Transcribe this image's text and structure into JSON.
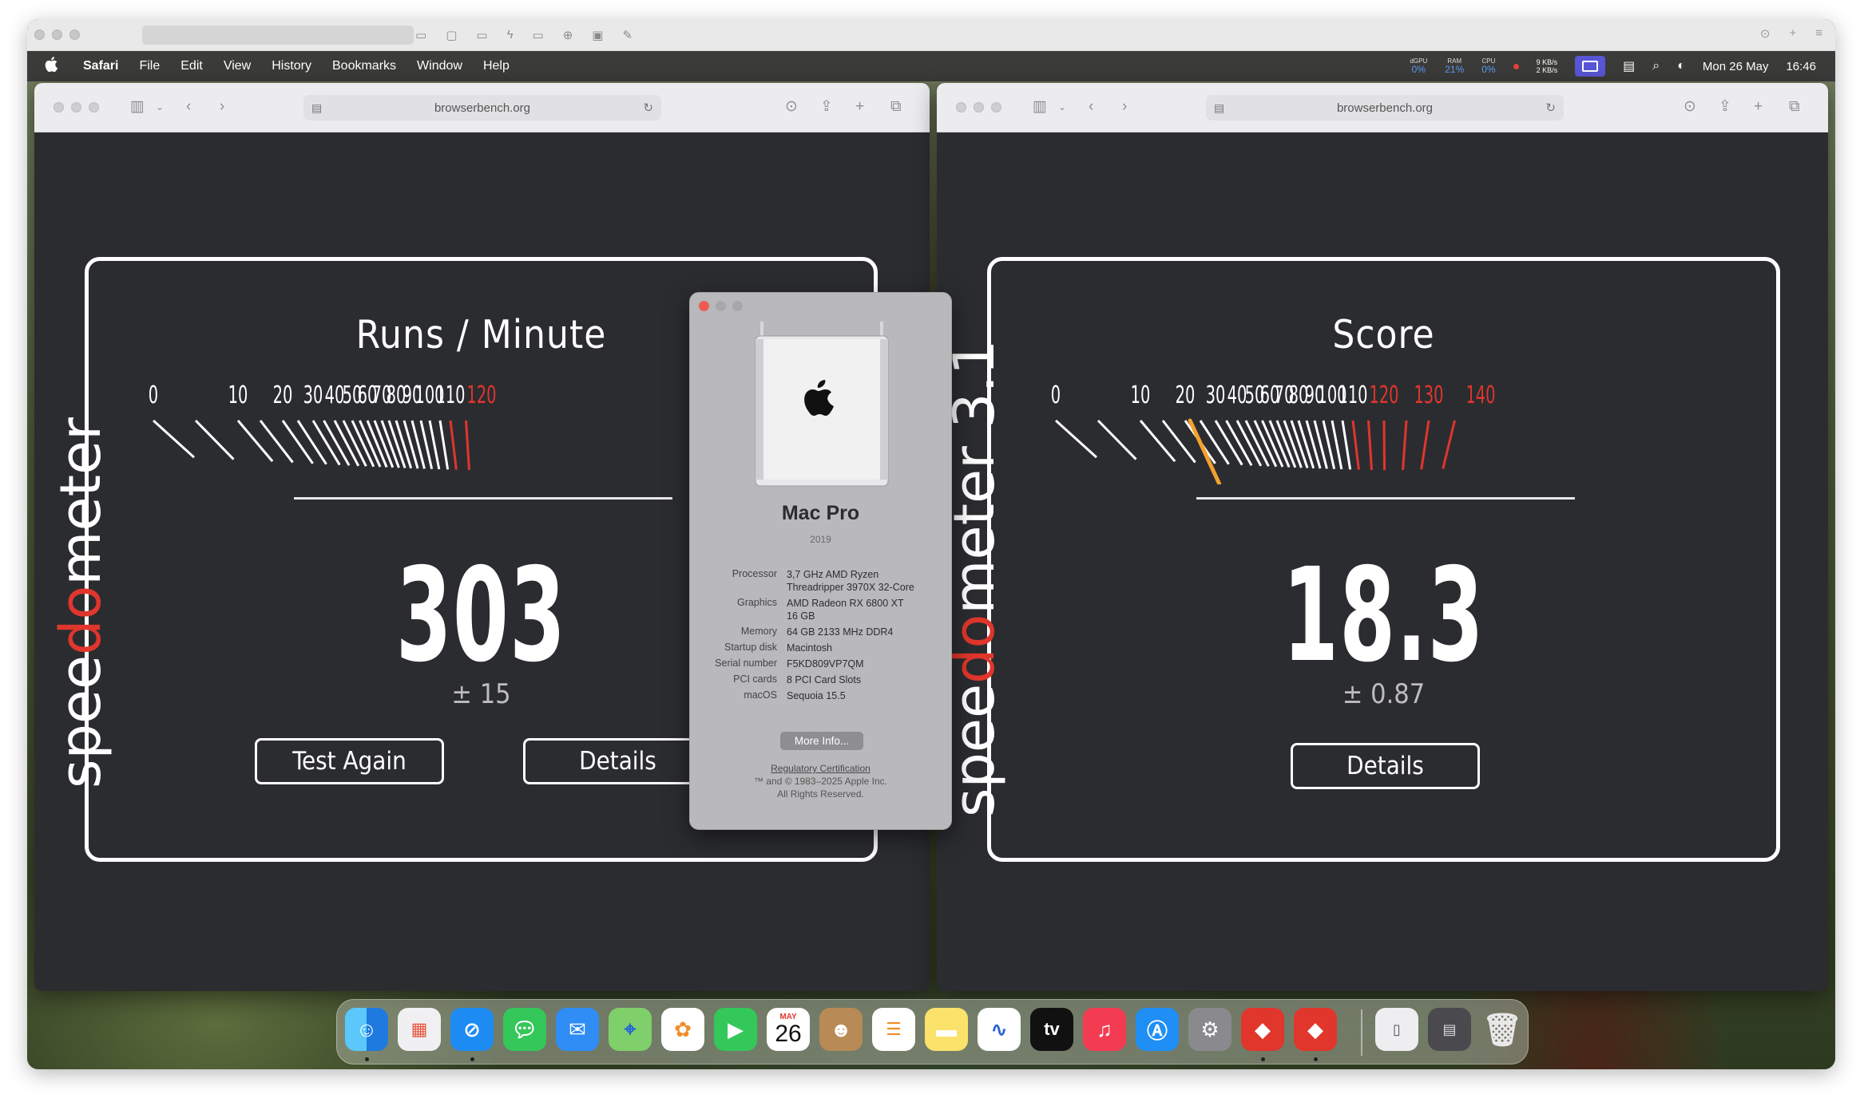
{
  "menubar": {
    "app_name": "Safari",
    "items": [
      "File",
      "Edit",
      "View",
      "History",
      "Bookmarks",
      "Window",
      "Help"
    ],
    "status": [
      {
        "label": "dGPU",
        "value": "0%"
      },
      {
        "label": "RAM",
        "value": "21%"
      },
      {
        "label": "CPU",
        "value": "0%"
      }
    ],
    "net_up": "9 KB/s",
    "net_down": "2 KB/s",
    "date": "Mon 26 May",
    "time": "16:46"
  },
  "left_window": {
    "address": "browserbench.org",
    "brand_prefix": "spee",
    "brand_red": "d",
    "brand_o": "o",
    "brand_suffix": "meter",
    "title": "Runs / Minute",
    "score": "303",
    "error": "± 15",
    "test_again_label": "Test Again",
    "details_label": "Details"
  },
  "right_window": {
    "address": "browserbench.org",
    "brand_prefix": "spee",
    "brand_red": "d",
    "brand_o": "o",
    "brand_suffix": "meter 3.1",
    "title": "Score",
    "score": "18.3",
    "error": "± 0.87",
    "details_label": "Details"
  },
  "gauge_ticks": [
    "0",
    "10",
    "20",
    "30",
    "40",
    "50",
    "60",
    "70",
    "80",
    "90",
    "100",
    "110",
    "120",
    "130",
    "140"
  ],
  "gauge_needle_value": 21.6,
  "colors": {
    "red": "#e0362c",
    "needle": "#f2a12d"
  },
  "about": {
    "model": "Mac Pro",
    "year": "2019",
    "specs": [
      {
        "key": "Processor",
        "value": "3,7 GHz AMD Ryzen Threadripper 3970X 32-Core"
      },
      {
        "key": "Graphics",
        "value": "AMD Radeon RX 6800 XT 16 GB"
      },
      {
        "key": "Memory",
        "value": "64 GB 2133 MHz DDR4"
      },
      {
        "key": "Startup disk",
        "value": "Macintosh"
      },
      {
        "key": "Serial number",
        "value": "F5KD809VP7QM"
      },
      {
        "key": "PCI cards",
        "value": "8 PCI Card Slots"
      },
      {
        "key": "macOS",
        "value": "Sequoia 15.5"
      }
    ],
    "more_info_label": "More Info...",
    "regulatory": "Regulatory Certification",
    "copyright": "™ and © 1983–2025 Apple Inc.",
    "rights": "All Rights Reserved."
  },
  "dock": {
    "calendar_month": "MAY",
    "calendar_day": "26",
    "tv_label": "tv"
  }
}
